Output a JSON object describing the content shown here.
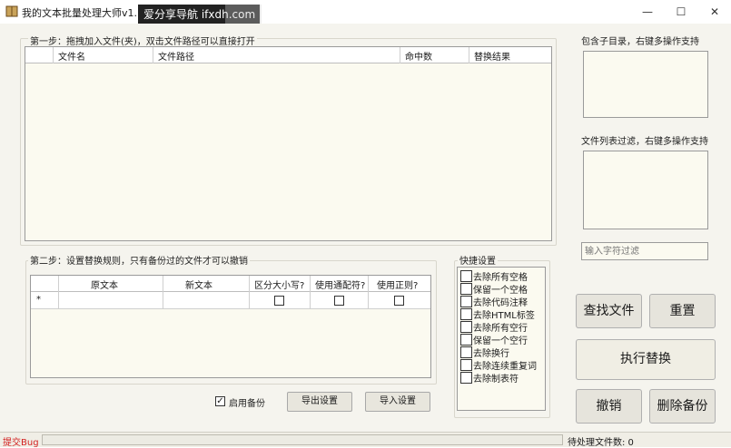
{
  "window": {
    "title": "我的文本批量处理大师v1.1.0 by",
    "overlay_text": "爱分享导航 ifxdh.com",
    "minimize": "—",
    "maximize": "☐",
    "close": "✕"
  },
  "step1": {
    "label": "第一步：拖拽加入文件(夹)，双击文件路径可以直接打开",
    "columns": [
      "文件名",
      "文件路径",
      "命中数",
      "替换结果"
    ]
  },
  "right_panel": {
    "subdir_label": "包含子目录，右键多操作支持",
    "filter_label": "文件列表过滤，右键多操作支持",
    "filter_placeholder": "输入字符过滤"
  },
  "step2": {
    "label": "第二步：设置替换规则，只有备份过的文件才可以撤销",
    "columns": [
      "原文本",
      "新文本",
      "区分大小写?",
      "使用通配符?",
      "使用正则?"
    ],
    "new_row_marker": "*"
  },
  "quick": {
    "label": "快捷设置",
    "items": [
      "去除所有空格",
      "保留一个空格",
      "去除代码注释",
      "去除HTML标签",
      "去除所有空行",
      "保留一个空行",
      "去除换行",
      "去除连续重复词",
      "去除制表符"
    ]
  },
  "options": {
    "backup_label": "启用备份",
    "backup_checked": true,
    "export_button": "导出设置",
    "import_button": "导入设置"
  },
  "buttons": {
    "find": "查找文件",
    "reset": "重置",
    "execute": "执行替换",
    "undo": "撤销",
    "delete_backup": "删除备份"
  },
  "status": {
    "bug_link": "提交Bug",
    "pending_text": "待处理文件数: 0"
  },
  "colors": {
    "client_bg": "#f5f4ee",
    "grid_bg": "#fbfaf0",
    "bug_link": "#d32020"
  }
}
